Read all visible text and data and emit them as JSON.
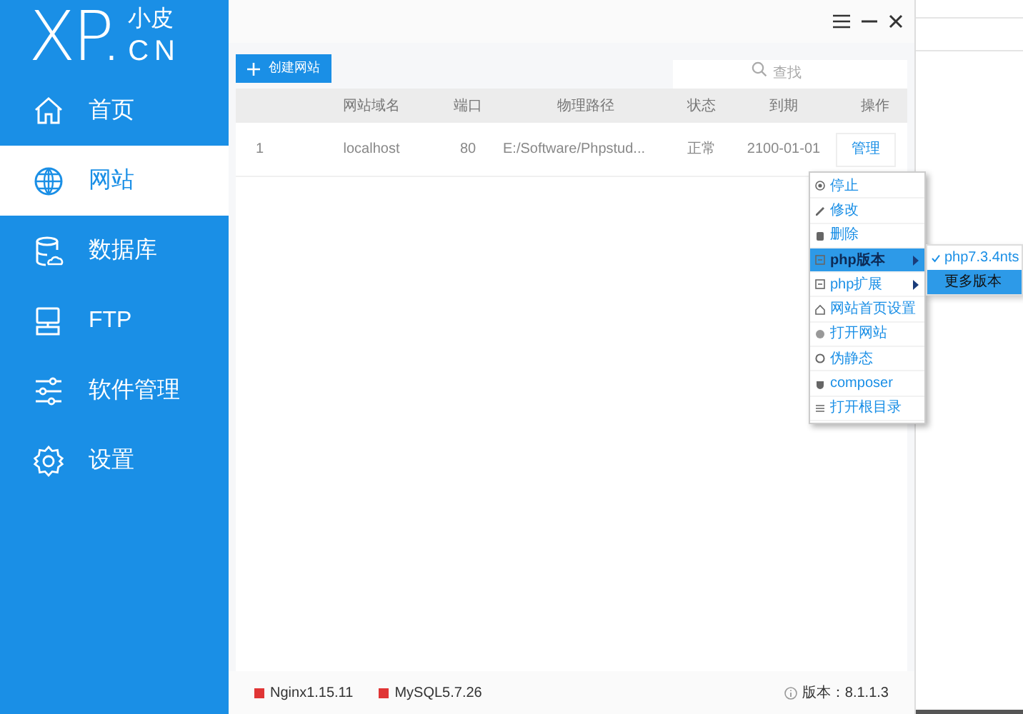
{
  "logo": {
    "mark": "XP.",
    "sub_top": "小皮",
    "sub_bottom": "CN"
  },
  "sidebar": {
    "items": [
      {
        "label": "首页",
        "selected": false
      },
      {
        "label": "网站",
        "selected": true
      },
      {
        "label": "数据库",
        "selected": false
      },
      {
        "label": "FTP",
        "selected": false
      },
      {
        "label": "软件管理",
        "selected": false
      },
      {
        "label": "设置",
        "selected": false
      }
    ]
  },
  "toolbar": {
    "create_button": "创建网站",
    "search": {
      "placeholder": "查找"
    }
  },
  "table": {
    "columns": [
      "",
      "网站域名",
      "端口",
      "物理路径",
      "状态",
      "到期",
      "操作"
    ],
    "rows": [
      {
        "cells": [
          "1",
          "localhost",
          "80",
          "E:/Software/Phpstud...",
          "正常",
          "2100-01-01"
        ],
        "action": "管理"
      }
    ]
  },
  "context_menu": {
    "items": [
      {
        "label": "停止",
        "selected": false,
        "submenu": false
      },
      {
        "label": "修改",
        "selected": false,
        "submenu": false
      },
      {
        "label": "删除",
        "selected": false,
        "submenu": false
      },
      {
        "label": "php版本",
        "selected": true,
        "submenu": true
      },
      {
        "label": "php扩展",
        "selected": false,
        "submenu": true
      },
      {
        "label": "网站首页设置",
        "selected": false,
        "submenu": false
      },
      {
        "label": "打开网站",
        "selected": false,
        "submenu": false
      },
      {
        "label": "伪静态",
        "selected": false,
        "submenu": false
      },
      {
        "label": "composer",
        "selected": false,
        "submenu": false
      },
      {
        "label": "打开根目录",
        "selected": false,
        "submenu": false
      }
    ]
  },
  "submenu": {
    "items": [
      {
        "label": "php7.3.4nts",
        "checked": true,
        "selected": false
      },
      {
        "label": "更多版本",
        "checked": false,
        "selected": true
      }
    ]
  },
  "status_bar": {
    "services": [
      {
        "label": "Nginx1.15.11",
        "color": "#e03535"
      },
      {
        "label": "MySQL5.7.26",
        "color": "#e03535"
      }
    ],
    "version": "版本：8.1.1.3"
  }
}
